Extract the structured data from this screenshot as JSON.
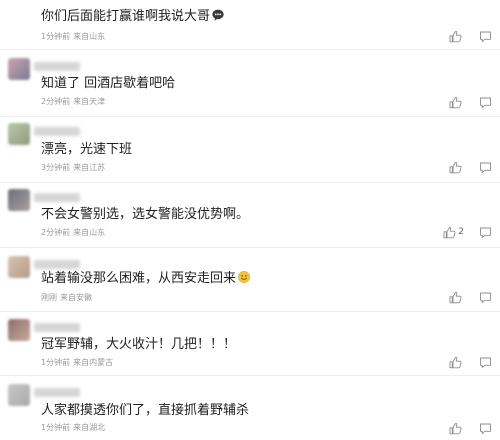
{
  "comments": [
    {
      "text": "你们后面能打赢谁啊我说大哥",
      "time": "1分钟前",
      "location": "来自山东",
      "likes": "",
      "emoji": "speech-bubble-icon",
      "avatar_colors": [
        "#cfcfcf",
        "#e6e6e6"
      ]
    },
    {
      "text": "知道了 回酒店歇着吧哈",
      "time": "2分钟前",
      "location": "来自天津",
      "likes": "",
      "emoji": "",
      "avatar_colors": [
        "#c9a6b4",
        "#7d7a8e"
      ]
    },
    {
      "text": "漂亮，光速下班",
      "time": "3分钟前",
      "location": "来自江苏",
      "likes": "",
      "emoji": "",
      "avatar_colors": [
        "#b9c6a8",
        "#8f9c7d"
      ]
    },
    {
      "text": "不会女警别选，选女警能没优势啊。",
      "time": "2分钟前",
      "location": "来自山东",
      "likes": "2",
      "emoji": "",
      "avatar_colors": [
        "#6b6f78",
        "#a8a0a0"
      ]
    },
    {
      "text": "站着输没那么困难，从西安走回来",
      "time": "刚刚",
      "location": "来自安徽",
      "likes": "",
      "emoji": "smiling-face-icon",
      "avatar_colors": [
        "#d9c3b0",
        "#b59a8a"
      ]
    },
    {
      "text": "冠军野辅，大火收汁！几把！！！",
      "time": "1分钟前",
      "location": "来自内蒙古",
      "likes": "",
      "emoji": "",
      "avatar_colors": [
        "#8e6f6a",
        "#c6a99a"
      ]
    },
    {
      "text": "人家都摸透你们了，直接抓着野辅杀",
      "time": "1分钟前",
      "location": "来自湖北",
      "likes": "",
      "emoji": "",
      "avatar_colors": [
        "#c8c8c8",
        "#a9a9a9"
      ]
    }
  ]
}
